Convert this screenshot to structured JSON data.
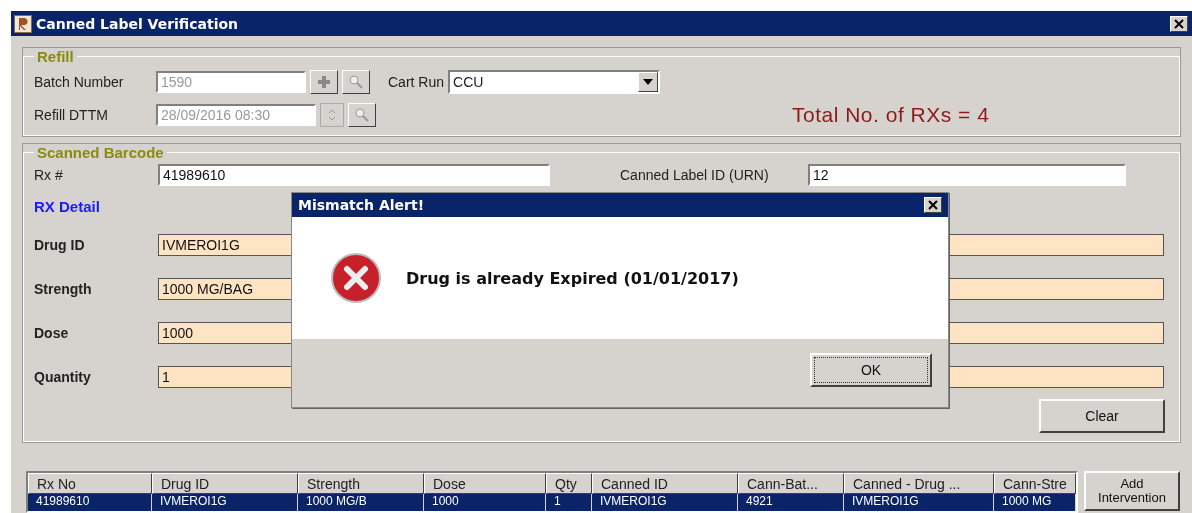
{
  "window": {
    "title": "Canned Label Verification"
  },
  "refill": {
    "title": "Refill",
    "batch_number": {
      "label": "Batch Number",
      "value": "1590",
      "disabled": true
    },
    "refill_dttm": {
      "label": "Refill DTTM",
      "value": "28/09/2016 08:30",
      "disabled": true
    },
    "cart_run": {
      "label": "Cart Run",
      "value": "CCU"
    },
    "total": "Total No. of RXs = 4"
  },
  "scanned": {
    "title": "Scanned Barcode",
    "rx": {
      "label": "Rx #",
      "value": "41989610"
    },
    "canned_label": {
      "label": "Canned Label ID (URN)",
      "value": "12"
    },
    "detail_title": "RX Detail",
    "details": [
      {
        "label": "Drug ID",
        "value": "IVMEROI1G"
      },
      {
        "label": "Strength",
        "value": "1000 MG/BAG"
      },
      {
        "label": "Dose",
        "value": "1000"
      },
      {
        "label": "Quantity",
        "value": "1"
      }
    ],
    "clear_button": "Clear"
  },
  "table": {
    "columns": [
      "Rx No",
      "Drug ID",
      "Strength",
      "Dose",
      "Qty",
      "Canned ID",
      "Cann-Bat...",
      "Canned - Drug ...",
      "Cann-Stre"
    ],
    "rows": [
      {
        "selected": true,
        "cells": [
          "41989610",
          "IVMEROI1G",
          "1000 MG/B",
          "1000",
          "1",
          "IVMEROI1G",
          "4921",
          "IVMEROI1G",
          "1000 MG"
        ]
      }
    ]
  },
  "add_intervention_button": "Add Intervention",
  "dialog": {
    "title": "Mismatch Alert!",
    "message": "Drug is already Expired (01/01/2017)",
    "ok_button": "OK"
  }
}
